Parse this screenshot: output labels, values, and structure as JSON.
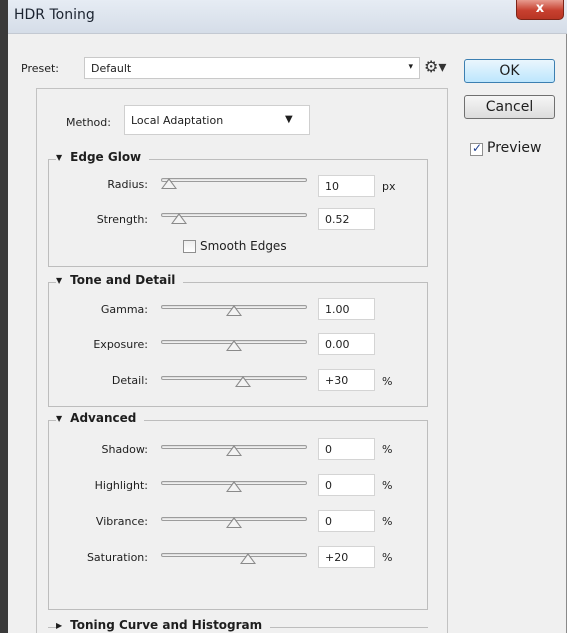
{
  "window": {
    "title": "HDR Toning",
    "close_label": "x"
  },
  "preset": {
    "label": "Preset:",
    "value": "Default",
    "arrow": "▾",
    "gear": "⚙▾"
  },
  "buttons": {
    "ok": "OK",
    "cancel": "Cancel"
  },
  "preview": {
    "label": "Preview",
    "checked": true
  },
  "method": {
    "label": "Method:",
    "value": "Local Adaptation",
    "arrow": "▼"
  },
  "groups": {
    "edge_glow": {
      "title": "Edge Glow",
      "rows": [
        {
          "label": "Radius:",
          "value": "10",
          "unit": "px",
          "slider_fraction": 0.05
        },
        {
          "label": "Strength:",
          "value": "0.52",
          "unit": "",
          "slider_fraction": 0.12
        }
      ],
      "smooth_edges": {
        "label": "Smooth Edges",
        "checked": false
      }
    },
    "tone_detail": {
      "title": "Tone and Detail",
      "rows": [
        {
          "label": "Gamma:",
          "value": "1.00",
          "unit": "",
          "slider_fraction": 0.5
        },
        {
          "label": "Exposure:",
          "value": "0.00",
          "unit": "",
          "slider_fraction": 0.5
        },
        {
          "label": "Detail:",
          "value": "+30",
          "unit": "%",
          "slider_fraction": 0.56
        }
      ]
    },
    "advanced": {
      "title": "Advanced",
      "rows": [
        {
          "label": "Shadow:",
          "value": "0",
          "unit": "%",
          "slider_fraction": 0.5
        },
        {
          "label": "Highlight:",
          "value": "0",
          "unit": "%",
          "slider_fraction": 0.5
        },
        {
          "label": "Vibrance:",
          "value": "0",
          "unit": "%",
          "slider_fraction": 0.5
        },
        {
          "label": "Saturation:",
          "value": "+20",
          "unit": "%",
          "slider_fraction": 0.6
        }
      ]
    },
    "toning_curve": {
      "title": "Toning Curve and Histogram",
      "expanded": false
    }
  },
  "colors": {
    "panel_bg": "#f0f0f0",
    "ok_accent": "#3c7fb1",
    "close_red": "#c7402f"
  }
}
